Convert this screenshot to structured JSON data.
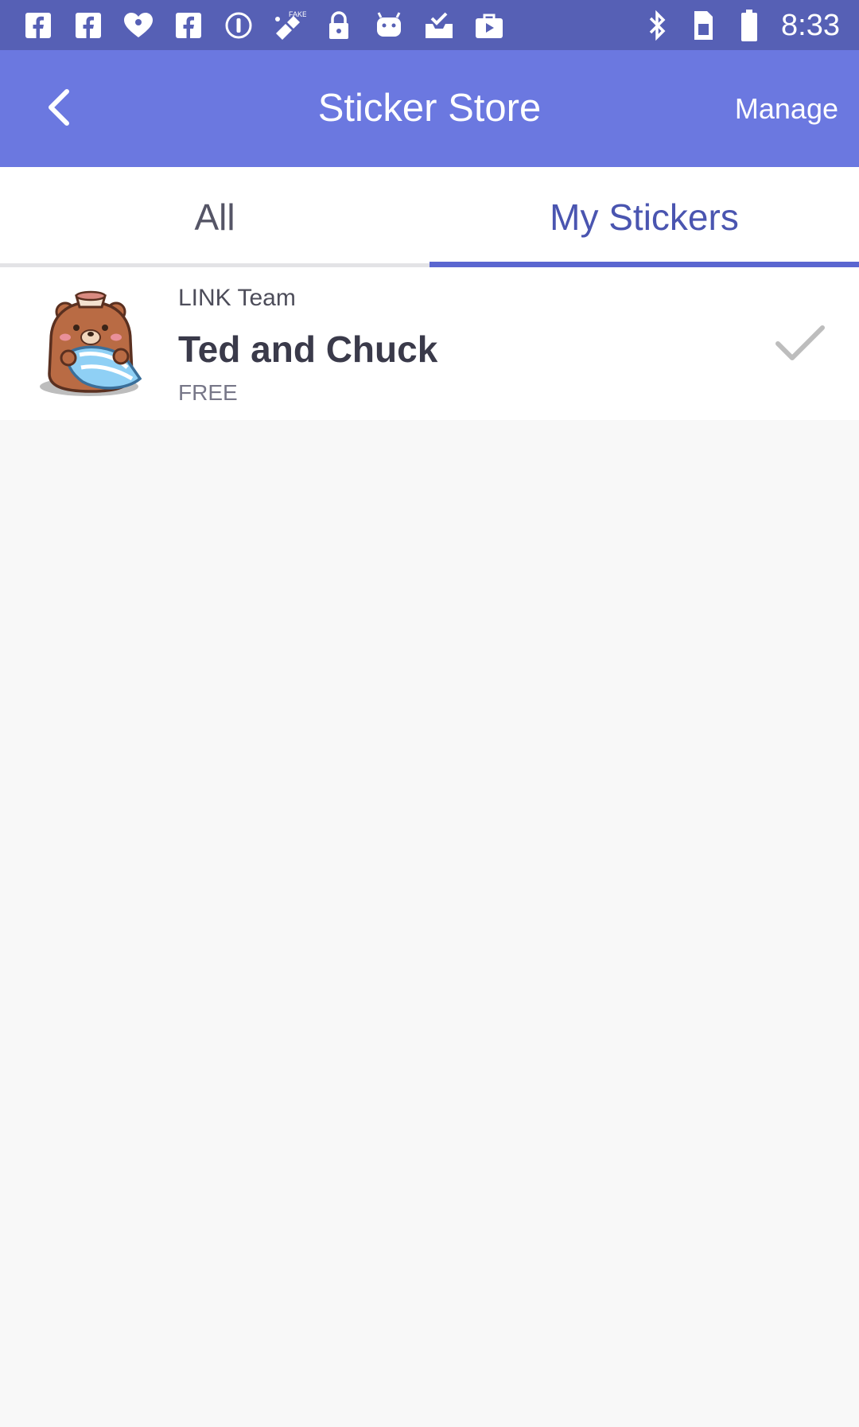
{
  "status_bar": {
    "time": "8:33",
    "left_icons": [
      "facebook-icon",
      "facebook-icon",
      "iheartradio-icon",
      "facebook-icon",
      "info-circle-icon",
      "fake-gps-icon",
      "lock-icon",
      "android-icon",
      "inbox-check-icon",
      "briefcase-icon"
    ],
    "right_icons": [
      "bluetooth-icon",
      "sim-card-icon",
      "battery-icon"
    ],
    "color": "#5660b5"
  },
  "app_bar": {
    "title": "Sticker Store",
    "manage_label": "Manage",
    "back_icon": "chevron-left-icon",
    "color": "#6b78e0"
  },
  "tabs": [
    {
      "label": "All",
      "selected": false
    },
    {
      "label": "My Stickers",
      "selected": true
    }
  ],
  "accent_color": "#5a66d0",
  "sticker_list": [
    {
      "author": "LINK Team",
      "title": "Ted and Chuck",
      "price": "FREE",
      "thumbnail_icon": "bear-with-pillow-icon",
      "status_icon": "check-icon",
      "installed": true
    }
  ]
}
